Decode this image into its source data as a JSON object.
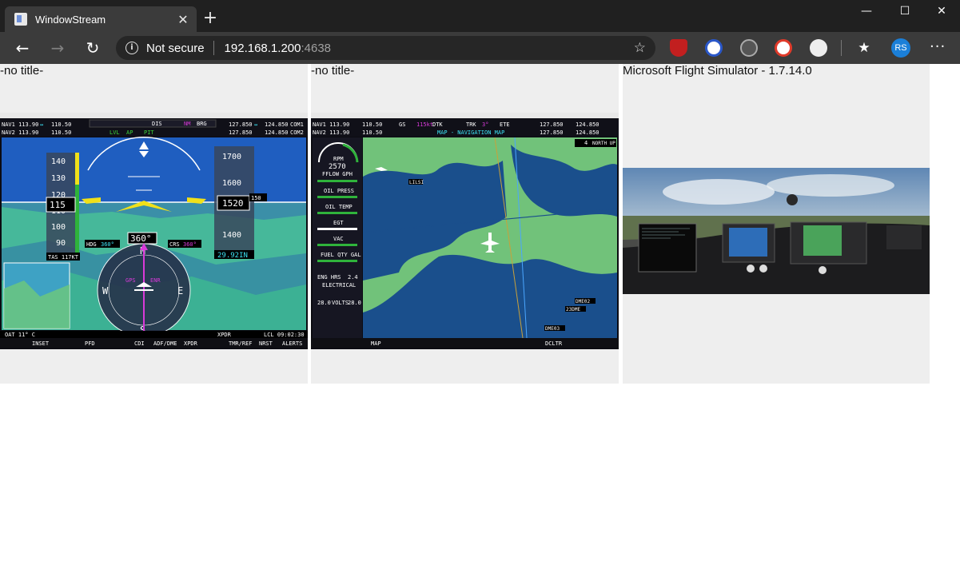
{
  "browser": {
    "tab_title": "WindowStream",
    "tab_close": "✕",
    "new_tab": "+",
    "window_controls": {
      "minimize": "—",
      "maximize": "☐",
      "close": "✕"
    },
    "security_label": "Not secure",
    "url_host": "192.168.1.200",
    "url_port": ":4638",
    "profile_initials": "RS",
    "more_label": "···"
  },
  "panels": [
    {
      "title": "-no title-"
    },
    {
      "title": "-no title-"
    },
    {
      "title": "Microsoft Flight Simulator - 1.7.14.0"
    }
  ],
  "pfd": {
    "nav1": "NAV1 113.90",
    "nav1_stby": "110.50",
    "nav2": "NAV2 113.90",
    "nav2_stby": "110.50",
    "dis": "DIS",
    "nm": "NM",
    "brg": "BRG",
    "com1": "127.850",
    "com1_stby": "124.850",
    "com1_label": "COM1",
    "com2": "127.850",
    "com2_stby": "124.850",
    "com2_label": "COM2",
    "lvl": "LVL",
    "ap": "AP",
    "pit": "PIT",
    "speed_tape": [
      "140",
      "130",
      "120",
      "110",
      "100",
      "90"
    ],
    "airspeed": "115",
    "alt_tape": [
      "1700",
      "1600",
      "1500",
      "1400"
    ],
    "altitude": "1520",
    "alt_bug": "150",
    "baro": "29.92IN",
    "heading": "360°",
    "hdg_label": "HDG",
    "hdg_value": "360°",
    "crs_label": "CRS",
    "crs_value": "360°",
    "tas": "TAS 117KT",
    "oat": "OAT 11° C",
    "xpdr": "XPDR",
    "lcl": "LCL 09:02:30",
    "gps": "GPS",
    "enr": "ENR",
    "softkeys": [
      "INSET",
      "PFD",
      "CDI",
      "ADF/DME",
      "XPDR",
      "TMR/REF",
      "NRST",
      "ALERTS"
    ]
  },
  "mfd": {
    "gs": "GS",
    "gs_value": "115kt",
    "dtk": "DTK",
    "trk": "TRK",
    "trk_value": "3°",
    "ete": "ETE",
    "map_title": "MAP - NAVIGATION MAP",
    "north_up": "NORTH UP",
    "range": "4",
    "rpm_label": "RPM",
    "rpm": "2570",
    "fflow": "FFLOW GPH",
    "oil_press": "OIL PRESS",
    "oil_temp": "OIL TEMP",
    "egt": "EGT",
    "vac": "VAC",
    "fuel_qty": "FUEL QTY GAL",
    "eng_hrs": "ENG HRS",
    "eng_hrs_value": "2.4",
    "electrical": "ELECTRICAL",
    "volts_l": "28.0",
    "volts": "VOLTS",
    "volts_r": "28.0",
    "waypoints": [
      "LILSI",
      "DME02",
      "23DME",
      "DME03"
    ],
    "softkeys": [
      "MAP",
      "DCLTR"
    ]
  }
}
